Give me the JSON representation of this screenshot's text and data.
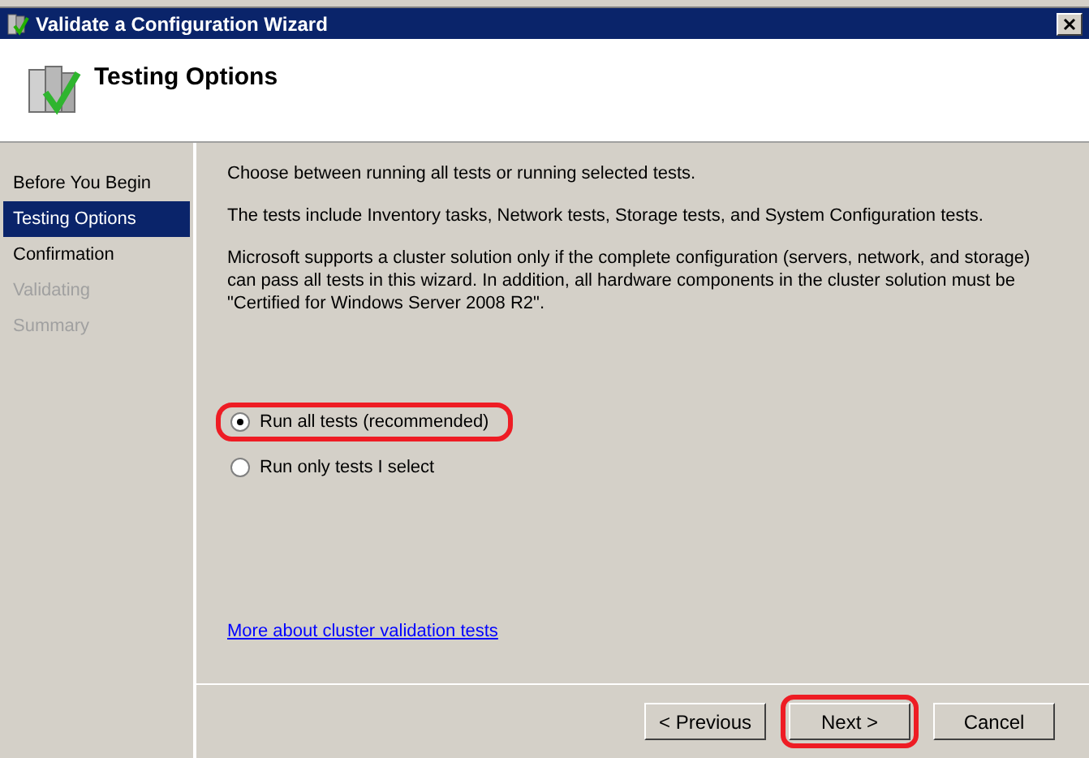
{
  "window": {
    "title": "Validate a Configuration Wizard"
  },
  "header": {
    "title": "Testing Options"
  },
  "steps": [
    {
      "label": "Before You Begin",
      "selected": false,
      "disabled": false
    },
    {
      "label": "Testing Options",
      "selected": true,
      "disabled": false
    },
    {
      "label": "Confirmation",
      "selected": false,
      "disabled": false
    },
    {
      "label": "Validating",
      "selected": false,
      "disabled": true
    },
    {
      "label": "Summary",
      "selected": false,
      "disabled": true
    }
  ],
  "paragraphs": [
    "Choose between running all tests or running selected tests.",
    "The tests include Inventory tasks, Network tests, Storage tests, and System Configuration tests.",
    "Microsoft supports a cluster solution only if the complete configuration (servers, network, and storage) can pass all tests in this wizard. In addition, all hardware components in the cluster solution must be \"Certified for Windows Server 2008 R2\"."
  ],
  "options": [
    {
      "label": "Run all tests (recommended)",
      "selected": true,
      "highlighted": true
    },
    {
      "label": "Run only tests I select",
      "selected": false,
      "highlighted": false
    }
  ],
  "link": "More about cluster validation tests",
  "buttons": [
    {
      "label": "< Previous",
      "highlighted": false
    },
    {
      "label": "Next >",
      "highlighted": true
    },
    {
      "label": "Cancel",
      "highlighted": false
    }
  ]
}
